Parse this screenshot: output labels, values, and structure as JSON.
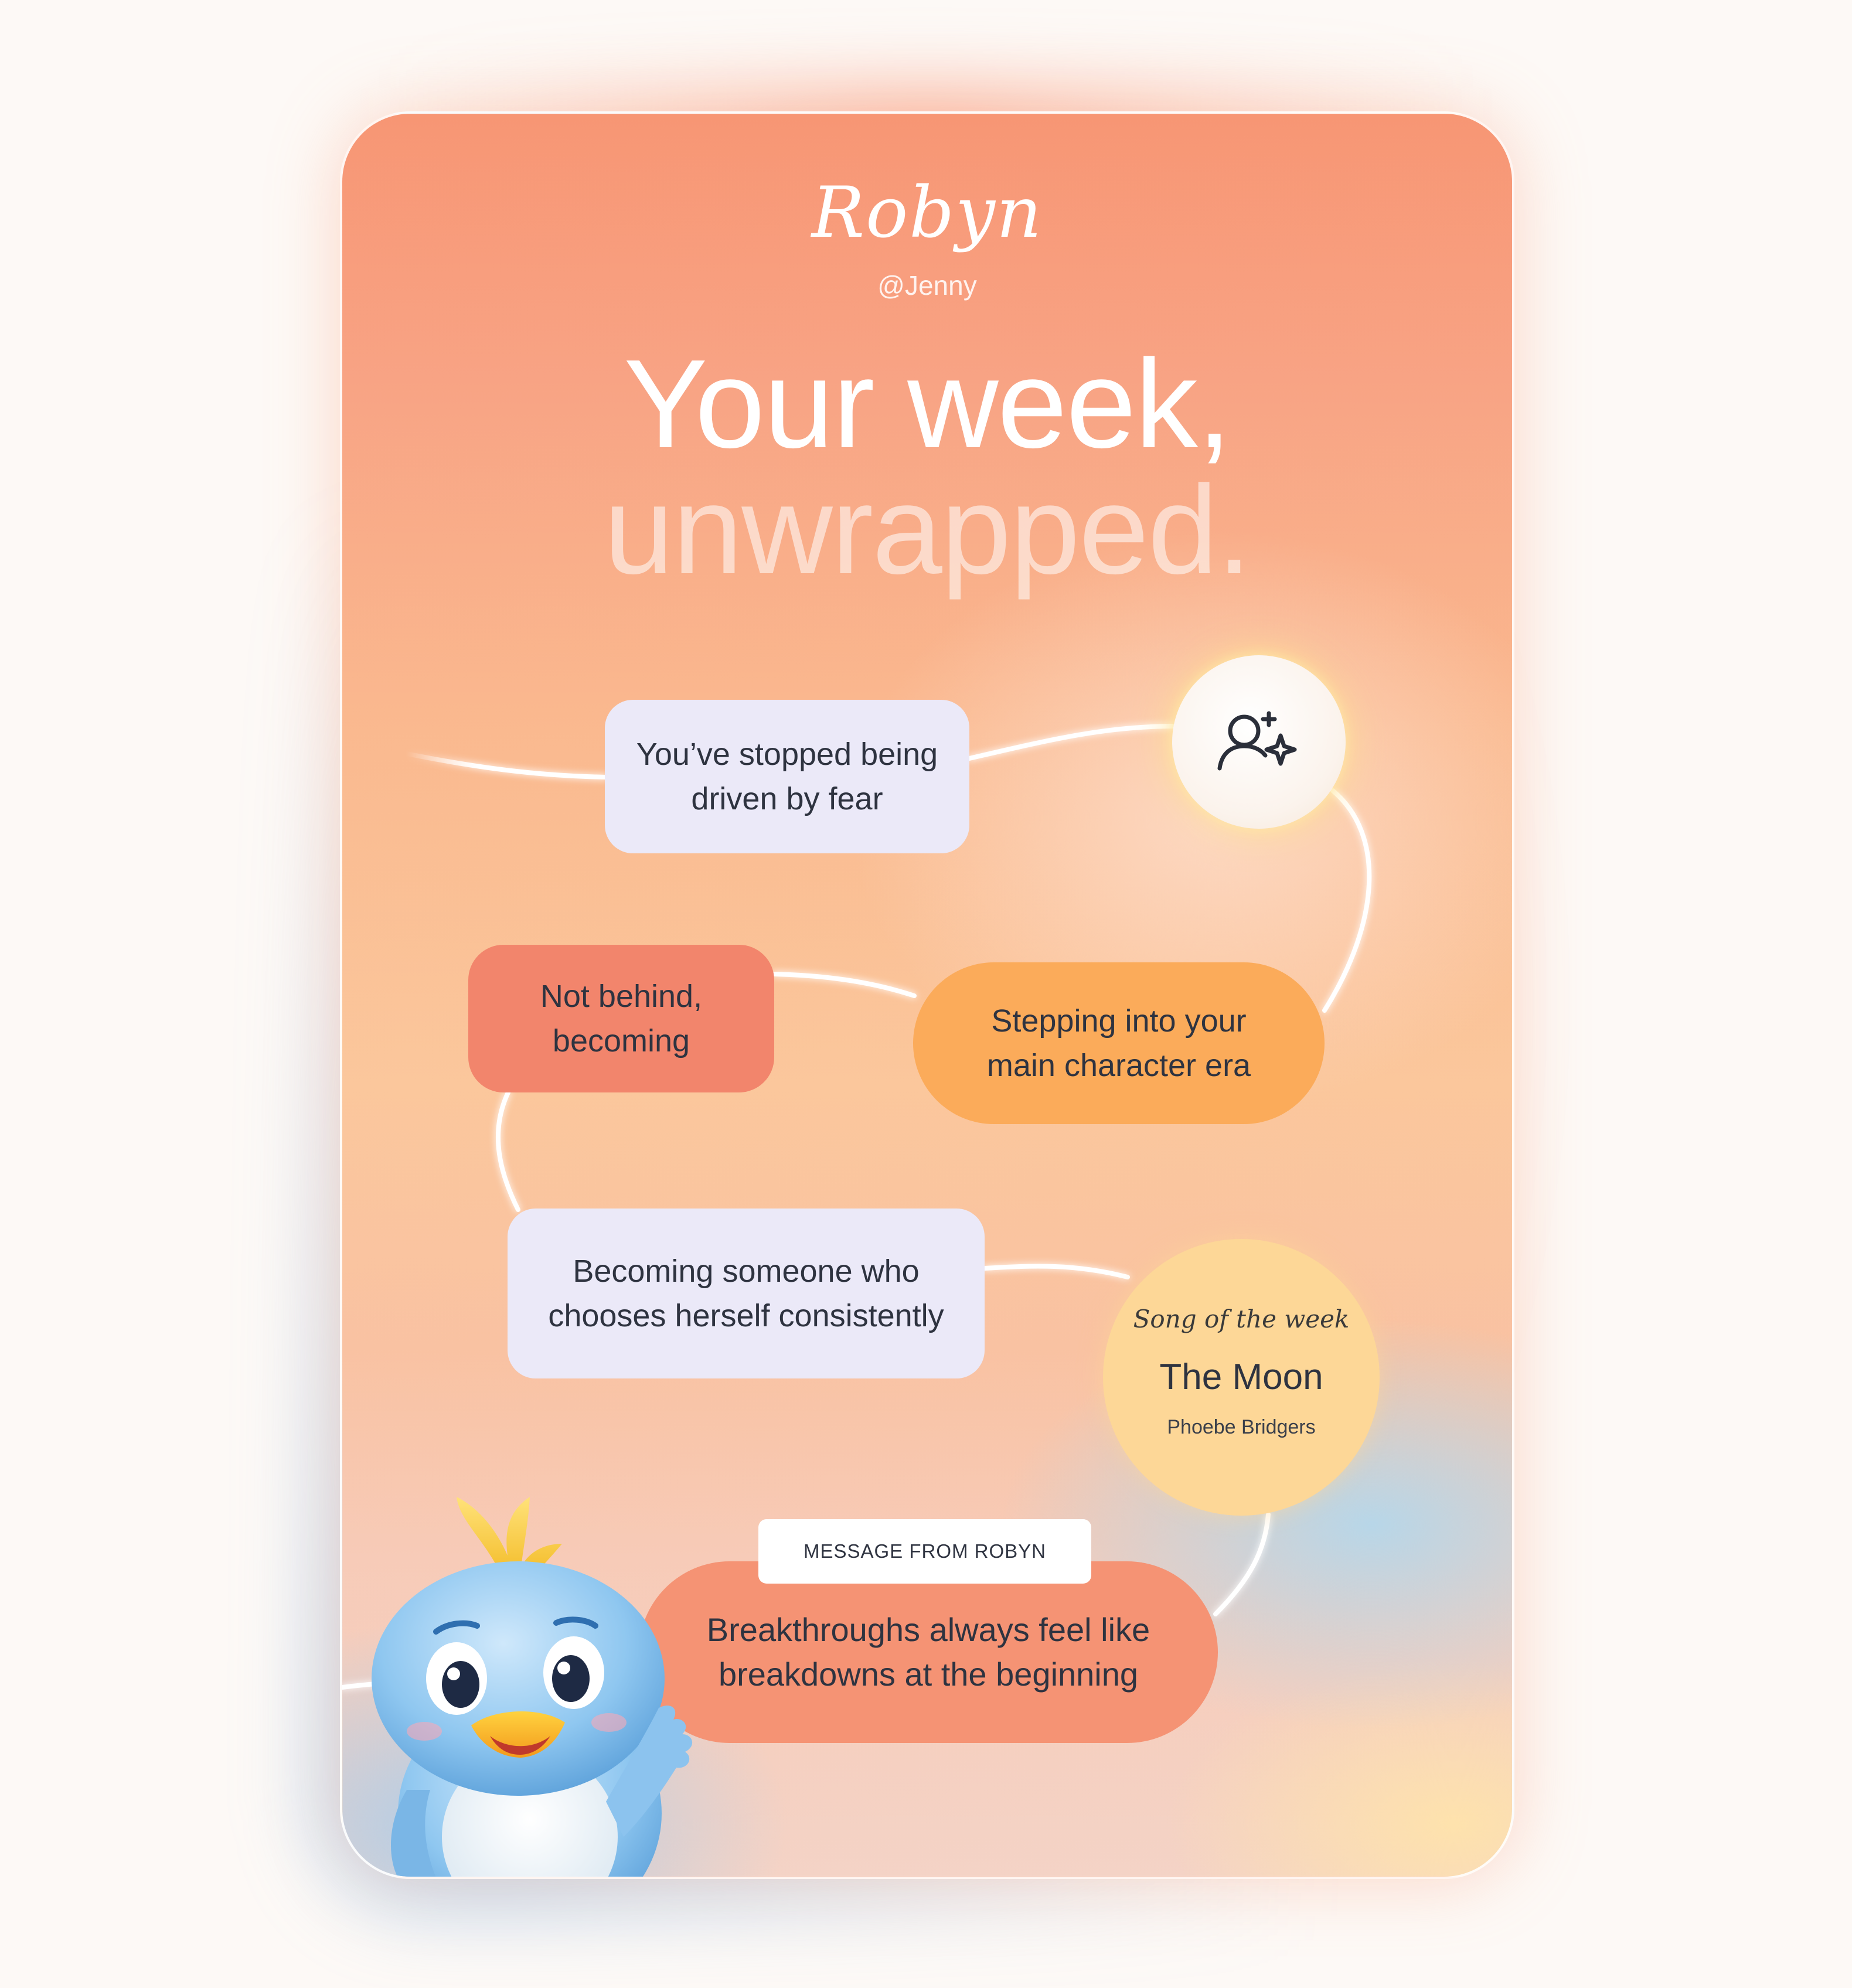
{
  "brand": {
    "logo_text": "Robyn",
    "handle": "@Jenny"
  },
  "headline": {
    "line1": "Your week,",
    "line2": "unwrapped."
  },
  "insights": [
    {
      "text": "You’ve stopped being\ndriven by fear"
    },
    {
      "text": "Not behind,\nbecoming"
    },
    {
      "text": "Stepping into your\nmain character era"
    },
    {
      "text": "Becoming someone who\nchooses herself consistently"
    }
  ],
  "song": {
    "kicker": "Song of the week",
    "title": "The Moon",
    "artist": "Phoebe Bridgers"
  },
  "message": {
    "label": "MESSAGE FROM ROBYN",
    "text": "Breakthroughs always feel like\nbreakdowns at the beginning"
  },
  "icons": {
    "top_icon": "user-sparkle-icon",
    "mascot": "bluebird-mascot"
  },
  "colors": {
    "card_top": "#f79674",
    "lilac": "#ebe9f8",
    "coral": "#f2856c",
    "orange": "#fbab5a",
    "song_yellow": "#fdd797",
    "message_coral": "#f59374",
    "text_dark": "#2e3340"
  }
}
